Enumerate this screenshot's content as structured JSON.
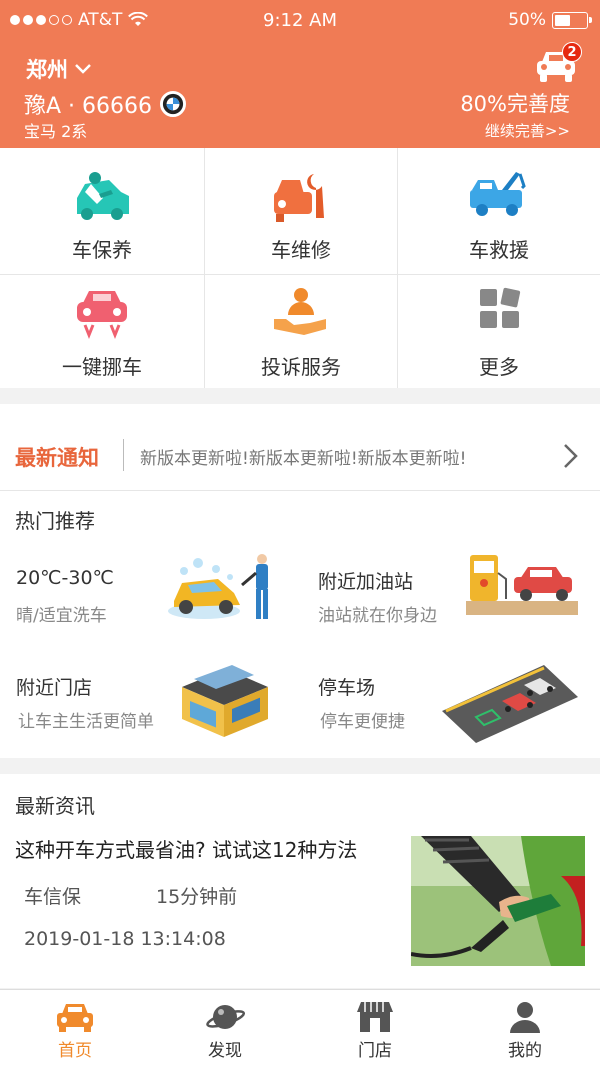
{
  "status_bar": {
    "carrier": "AT&T",
    "time": "9:12 AM",
    "battery": "50%",
    "battery_level": 0.5
  },
  "header": {
    "city": "郑州",
    "plate": "豫A · 66666",
    "car_model": "宝马 2系",
    "notification_count": "2",
    "completeness": "80%完善度",
    "complete_link": "继续完善>>"
  },
  "services": [
    {
      "label": "车保养",
      "icon": "car-maintenance-icon",
      "color": "#26c6b6"
    },
    {
      "label": "车维修",
      "icon": "car-repair-icon",
      "color": "#f0703f"
    },
    {
      "label": "车救援",
      "icon": "tow-truck-icon",
      "color": "#3ca6e6"
    },
    {
      "label": "一键挪车",
      "icon": "move-car-icon",
      "color": "#f06070"
    },
    {
      "label": "投诉服务",
      "icon": "complaint-service-icon",
      "color": "#f08a2c"
    },
    {
      "label": "更多",
      "icon": "more-grid-icon",
      "color": "#888888"
    }
  ],
  "notice": {
    "tag": "最新通知",
    "text": "新版本更新啦!新版本更新啦!新版本更新啦!"
  },
  "hot": {
    "title": "热门推荐",
    "items": [
      {
        "title": "20℃-30℃",
        "subtitle": "晴/适宜洗车"
      },
      {
        "title": "附近加油站",
        "subtitle": "油站就在你身边"
      },
      {
        "title": "附近门店",
        "subtitle": "让车主生活更简单"
      },
      {
        "title": "停车场",
        "subtitle": "停车更便捷"
      }
    ]
  },
  "news": {
    "title": "最新资讯",
    "headline": "这种开车方式最省油? 试试这12种方法",
    "source": "车信保",
    "time_ago": "15分钟前",
    "date": "2019-01-18 13:14:08"
  },
  "tabs": [
    {
      "label": "首页",
      "icon": "home-car-icon",
      "active": true
    },
    {
      "label": "发现",
      "icon": "planet-icon",
      "active": false
    },
    {
      "label": "门店",
      "icon": "store-icon",
      "active": false
    },
    {
      "label": "我的",
      "icon": "user-icon",
      "active": false
    }
  ],
  "colors": {
    "brand": "#f07b55",
    "accent": "#f08a2c",
    "badge": "#e62a10"
  }
}
